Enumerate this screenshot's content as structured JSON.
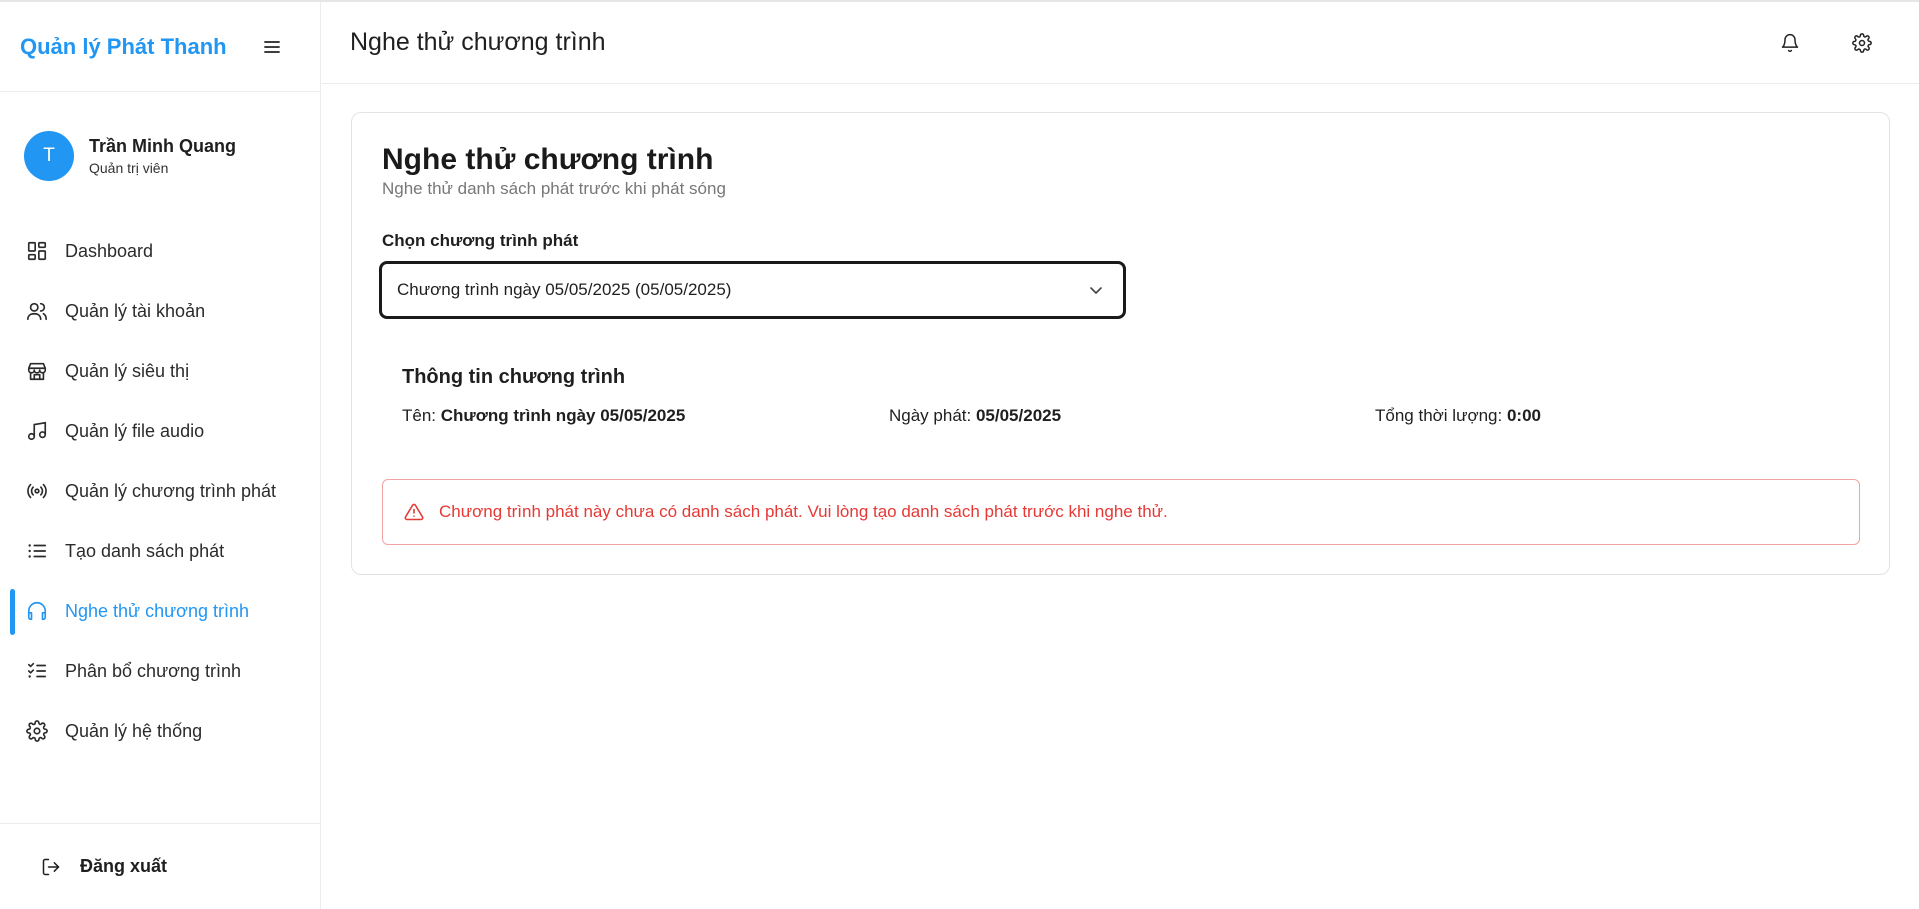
{
  "app": {
    "brand": "Quản lý Phát Thanh"
  },
  "user": {
    "initial": "T",
    "name": "Trần Minh Quang",
    "role": "Quản trị viên"
  },
  "sidebar": {
    "items": [
      {
        "label": "Dashboard",
        "icon": "dashboard-icon"
      },
      {
        "label": "Quản lý tài khoản",
        "icon": "users-icon"
      },
      {
        "label": "Quản lý siêu thị",
        "icon": "store-icon"
      },
      {
        "label": "Quản lý file audio",
        "icon": "music-note-icon"
      },
      {
        "label": "Quản lý chương trình phát",
        "icon": "broadcast-icon"
      },
      {
        "label": "Tạo danh sách phát",
        "icon": "list-icon"
      },
      {
        "label": "Nghe thử chương trình",
        "icon": "headphones-icon",
        "active": true
      },
      {
        "label": "Phân bổ chương trình",
        "icon": "checklist-icon"
      },
      {
        "label": "Quản lý hệ thống",
        "icon": "gear-icon"
      }
    ],
    "logout": "Đăng xuất"
  },
  "header": {
    "title": "Nghe thử chương trình"
  },
  "main": {
    "title": "Nghe thử chương trình",
    "subtitle": "Nghe thử danh sách phát trước khi phát sóng",
    "select_label": "Chọn chương trình phát",
    "select_value": "Chương trình ngày 05/05/2025 (05/05/2025)",
    "info": {
      "title": "Thông tin chương trình",
      "name_label": "Tên:",
      "name_value": "Chương trình ngày 05/05/2025",
      "date_label": "Ngày phát:",
      "date_value": "05/05/2025",
      "duration_label": "Tổng thời lượng:",
      "duration_value": "0:00"
    },
    "alert": "Chương trình phát này chưa có danh sách phát. Vui lòng tạo danh sách phát trước khi nghe thử."
  },
  "colors": {
    "accent": "#2196f3",
    "error": "#e53935",
    "error_border": "#f1a4a4"
  }
}
